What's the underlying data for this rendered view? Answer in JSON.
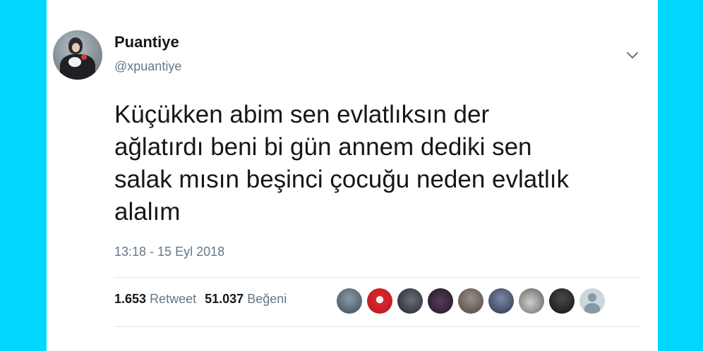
{
  "tweet": {
    "display_name": "Puantiye",
    "handle": "@xpuantiye",
    "text_lines": [
      "Küçükken abim sen evlatlıksın der",
      "ağlatırdı beni bi gün annem dediki sen",
      "salak mısın beşinci çocuğu neden evlatlık",
      "alalım"
    ],
    "timestamp": "13:18 - 15 Eyl 2018"
  },
  "stats": {
    "retweet_count": "1.653",
    "retweet_label": "Retweet",
    "like_count": "51.037",
    "like_label": "Beğeni"
  },
  "icons": {
    "menu": "chevron-down-icon",
    "default_avatar": "default-profile-icon"
  },
  "colors": {
    "background": "#00d8ff",
    "card": "#ffffff",
    "text_primary": "#14171a",
    "text_secondary": "#657786",
    "divider": "#e1e8ed"
  }
}
